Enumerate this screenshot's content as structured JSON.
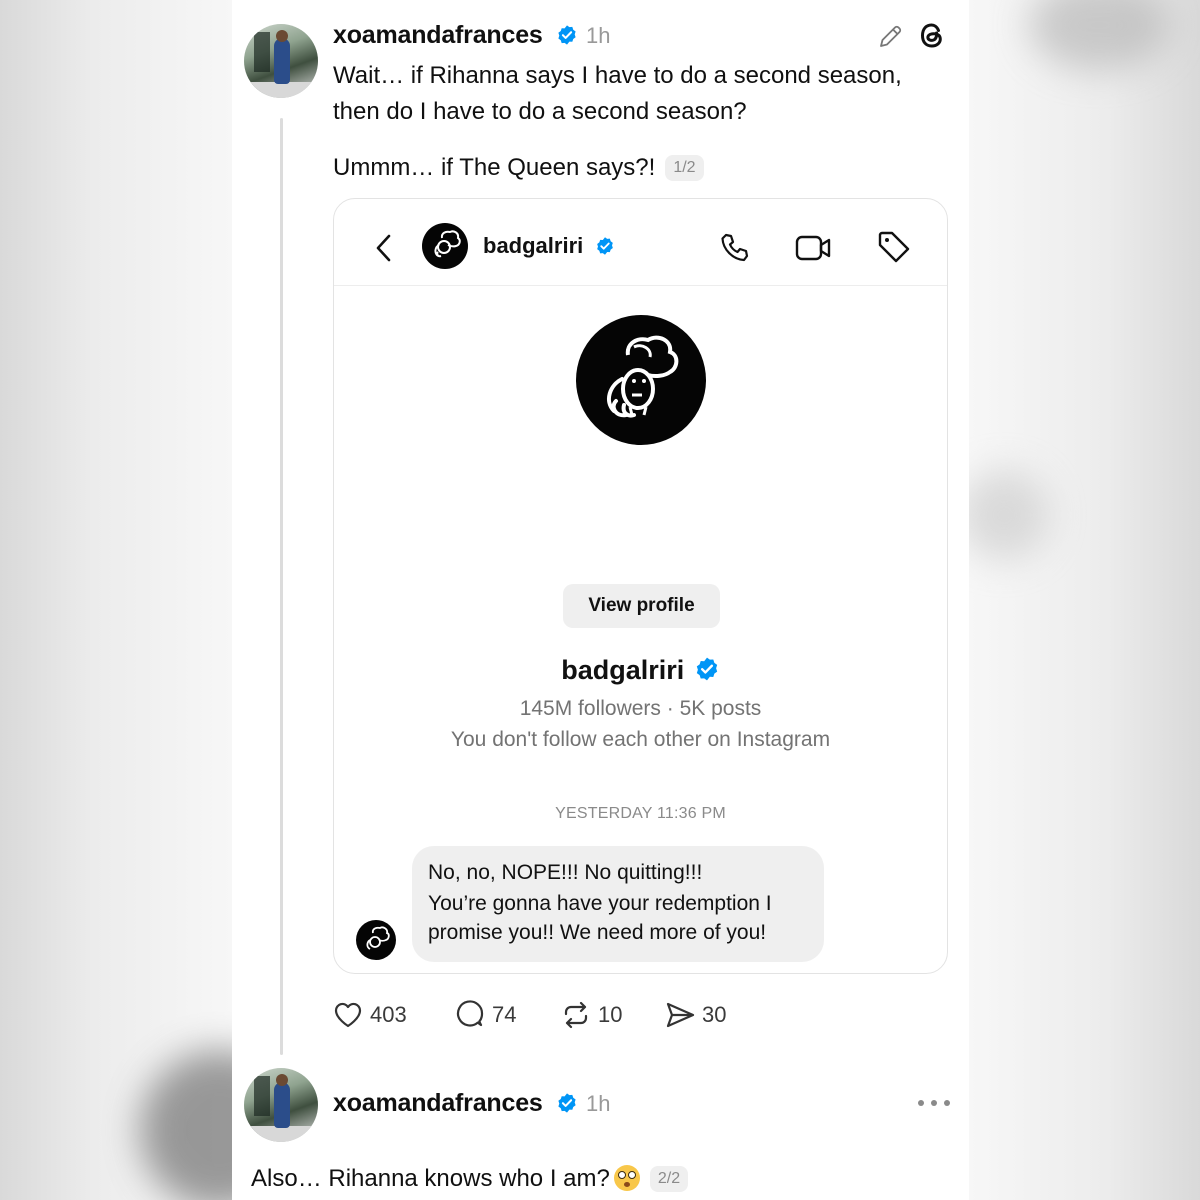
{
  "post1": {
    "username": "xoamandafrances",
    "time": "1h",
    "line1": "Wait… if Rihanna says I have to do a second season,",
    "line2": "then do I have to do a second season?",
    "line3": "Ummm… if The Queen says?!",
    "pager": "1/2",
    "icons": [
      "edit-pencil-icon",
      "threads-logo-icon"
    ]
  },
  "dm": {
    "header_name": "badgalriri",
    "header_icons": [
      "back-chevron-icon",
      "phone-icon",
      "video-camera-icon",
      "tag-icon"
    ],
    "profile_name": "badgalriri",
    "stats": "145M followers · 5K posts",
    "follow_note": "You don't follow each other on Instagram",
    "view_profile_label": "View profile",
    "timestamp": "YESTERDAY 11:36 PM",
    "message_line1": "No, no, NOPE!!! No quitting!!!",
    "message_line2": "You’re gonna have your redemption I",
    "message_line3": "promise you!! We need more of you!"
  },
  "actions": {
    "likes": "403",
    "replies": "74",
    "reposts": "10",
    "shares": "30"
  },
  "post2": {
    "username": "xoamandafrances",
    "time": "1h",
    "text": "Also… Rihanna knows who I am?",
    "pager": "2/2"
  },
  "colors": {
    "verified_blue": "#0095f6",
    "text": "#101010",
    "muted": "#999999",
    "bubble_bg": "#efefef"
  }
}
